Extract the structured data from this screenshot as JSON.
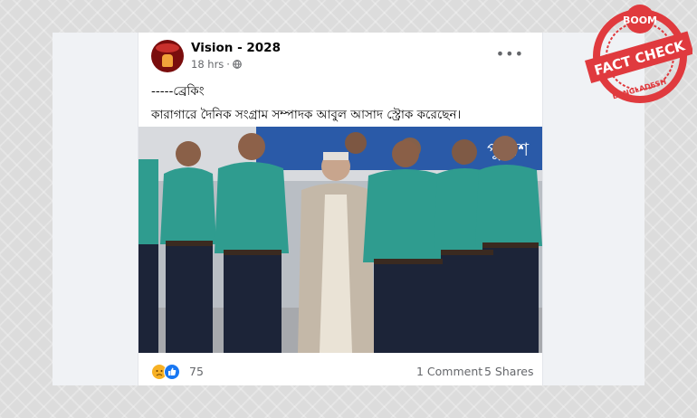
{
  "post": {
    "page_name": "Vision - 2028",
    "time": "18 hrs",
    "separator": "·",
    "line1": "-----ব্রেকিং",
    "line2": "কারাগারে দৈনিক সংগ্রাম সম্পাদক আবুল আসাদ স্ট্রোক করেছেন।",
    "photo_sign_text": "পুলিশ"
  },
  "reactions": {
    "count": "75",
    "comments": "1 Comment",
    "shares": "5 Shares",
    "icons": [
      "sad-icon",
      "like-icon"
    ]
  },
  "watermark": {
    "top": "BOOM",
    "middle": "FACT CHECK",
    "bottom": "BANGLADESH",
    "color": "#e03a3e"
  },
  "colors": {
    "uniform": "#2f9c8f",
    "trousers": "#1c2438",
    "background": "#dcdcdc",
    "card": "#ffffff"
  }
}
